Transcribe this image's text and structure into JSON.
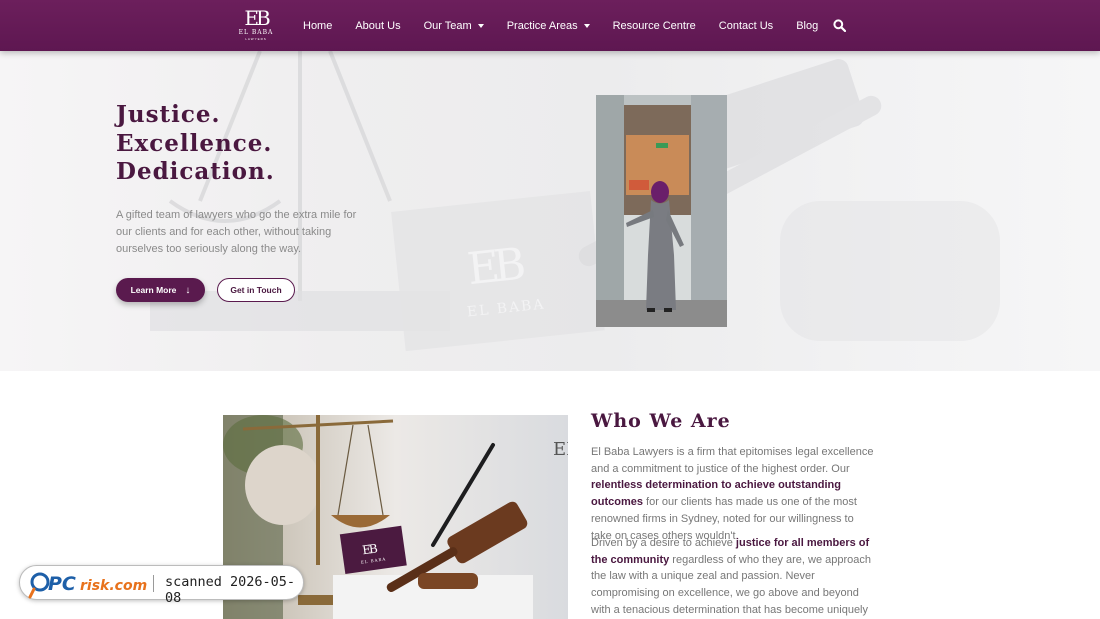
{
  "nav": {
    "logo_monogram": "EB",
    "logo_word": "EL BABA",
    "logo_sub": "LAWYERS",
    "items": [
      {
        "label": "Home",
        "dropdown": false
      },
      {
        "label": "About Us",
        "dropdown": false
      },
      {
        "label": "Our Team",
        "dropdown": true
      },
      {
        "label": "Practice Areas",
        "dropdown": true
      },
      {
        "label": "Resource Centre",
        "dropdown": false
      },
      {
        "label": "Contact Us",
        "dropdown": false
      },
      {
        "label": "Blog",
        "dropdown": false
      }
    ],
    "search_icon": "search-icon"
  },
  "hero": {
    "title_lines": [
      "Justice.",
      "Excellence.",
      "Dedication."
    ],
    "text": "A gifted team of lawyers who go the extra mile for our clients and for each other, without taking ourselves too seriously along the way.",
    "primary_button": "Learn More",
    "primary_button_icon": "arrow-down-icon",
    "secondary_button": "Get in Touch"
  },
  "who": {
    "title": "Who We Are",
    "p1_a": "El Baba Lawyers is a firm that epitomises legal excellence and a commitment to justice of the highest order. Our ",
    "p1_b": "relentless determination to achieve outstanding outcomes",
    "p1_c": " for our clients has made us one of the most renowned firms in Sydney, noted for our willingness to take on cases others wouldn't.",
    "p2_a": "Driven by a desire to achieve ",
    "p2_b": "justice for all members of the community",
    "p2_c": " regardless of who they are, we approach the law with a unique zeal and passion. Never compromising on excellence, we go above and beyond with a tenacious determination that has become uniquely associated with us."
  },
  "watermark": {
    "brand_pc": "PC",
    "brand_risk": "risk.com",
    "scanned": "scanned 2026-05-08"
  },
  "colors": {
    "brand": "#5a1a4e",
    "nav_bg": "#6c1f5c",
    "heading": "#4a1840"
  }
}
